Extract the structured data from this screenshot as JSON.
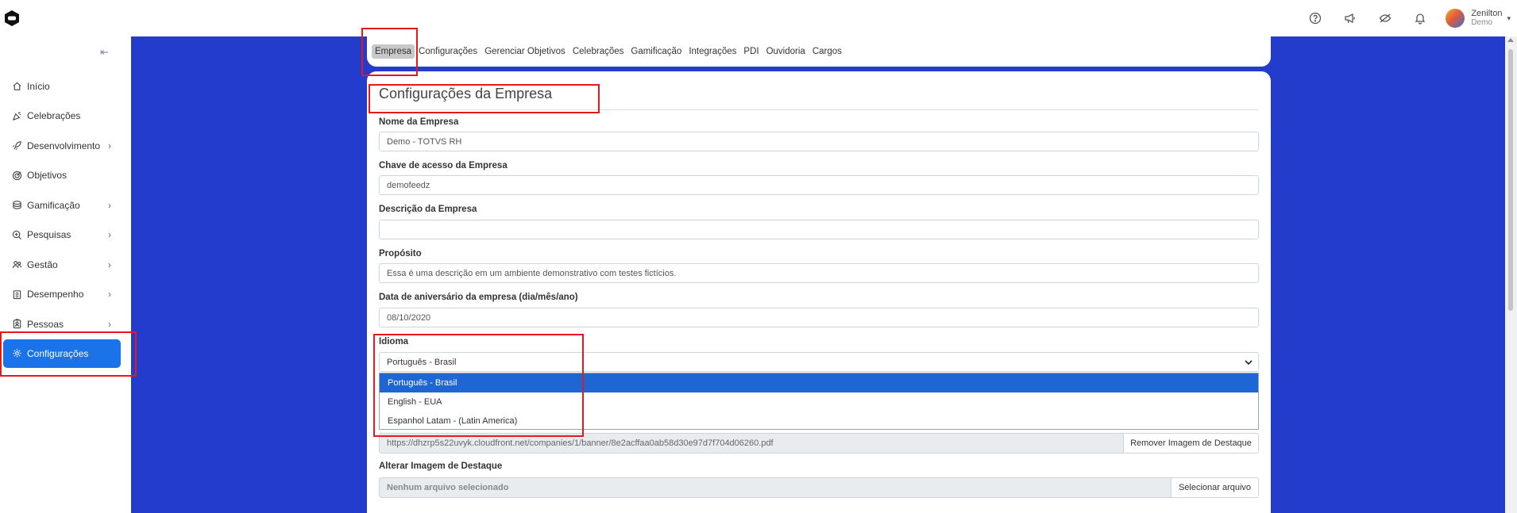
{
  "topbar": {
    "logo": "hexagon-logo-icon",
    "icons": [
      "help-icon",
      "megaphone-icon",
      "visibility-off-icon",
      "bell-icon"
    ],
    "user": {
      "name": "Zenilton",
      "org": "Demo"
    }
  },
  "sidebar": {
    "collapse_icon": "collapse-left-icon",
    "items": [
      {
        "label": "Início",
        "icon": "home-icon",
        "has_children": false
      },
      {
        "label": "Celebrações",
        "icon": "party-icon",
        "has_children": false
      },
      {
        "label": "Desenvolvimento",
        "icon": "rocket-icon",
        "has_children": true
      },
      {
        "label": "Objetivos",
        "icon": "target-icon",
        "has_children": false
      },
      {
        "label": "Gamificação",
        "icon": "coins-icon",
        "has_children": true
      },
      {
        "label": "Pesquisas",
        "icon": "search-icon",
        "has_children": true
      },
      {
        "label": "Gestão",
        "icon": "team-icon",
        "has_children": true
      },
      {
        "label": "Desempenho",
        "icon": "clipboard-icon",
        "has_children": true
      },
      {
        "label": "Pessoas",
        "icon": "badge-icon",
        "has_children": true
      },
      {
        "label": "Configurações",
        "icon": "gear-icon",
        "has_children": false,
        "active": true
      }
    ]
  },
  "tabs": [
    {
      "label": "Empresa",
      "active": true
    },
    {
      "label": "Configurações"
    },
    {
      "label": "Gerenciar Objetivos"
    },
    {
      "label": "Celebrações"
    },
    {
      "label": "Gamificação"
    },
    {
      "label": "Integrações"
    },
    {
      "label": "PDI"
    },
    {
      "label": "Ouvidoria"
    },
    {
      "label": "Cargos"
    }
  ],
  "form": {
    "title": "Configurações da Empresa",
    "company_name_label": "Nome da Empresa",
    "company_name_value": "Demo - TOTVS RH",
    "access_key_label": "Chave de acesso da Empresa",
    "access_key_value": "demofeedz",
    "description_label": "Descrição da Empresa",
    "description_value": "",
    "purpose_label": "Propósito",
    "purpose_value": "Essa é uma descrição em um ambiente demonstrativo com testes fictícios.",
    "anniversary_label": "Data de aniversário da empresa (dia/mês/ano)",
    "anniversary_value": "08/10/2020",
    "language_label": "Idioma",
    "language_selected": "Português - Brasil",
    "language_options": [
      "Português - Brasil",
      "English - EUA",
      "Espanhol Latam - (Latin America)"
    ],
    "banner_url": "https://dhzrp5s22uvyk.cloudfront.net/companies/1/banner/8e2acffaa0ab58d30e97d7f704d06260.pdf",
    "remove_banner_label": "Remover Imagem de Destaque",
    "change_banner_label": "Alterar Imagem de Destaque",
    "no_file_label": "Nenhum arquivo selecionado",
    "select_file_label": "Selecionar arquivo"
  },
  "colors": {
    "main_bg": "#233ccc",
    "accent": "#1a73e8",
    "annotation": "#e8171b"
  }
}
